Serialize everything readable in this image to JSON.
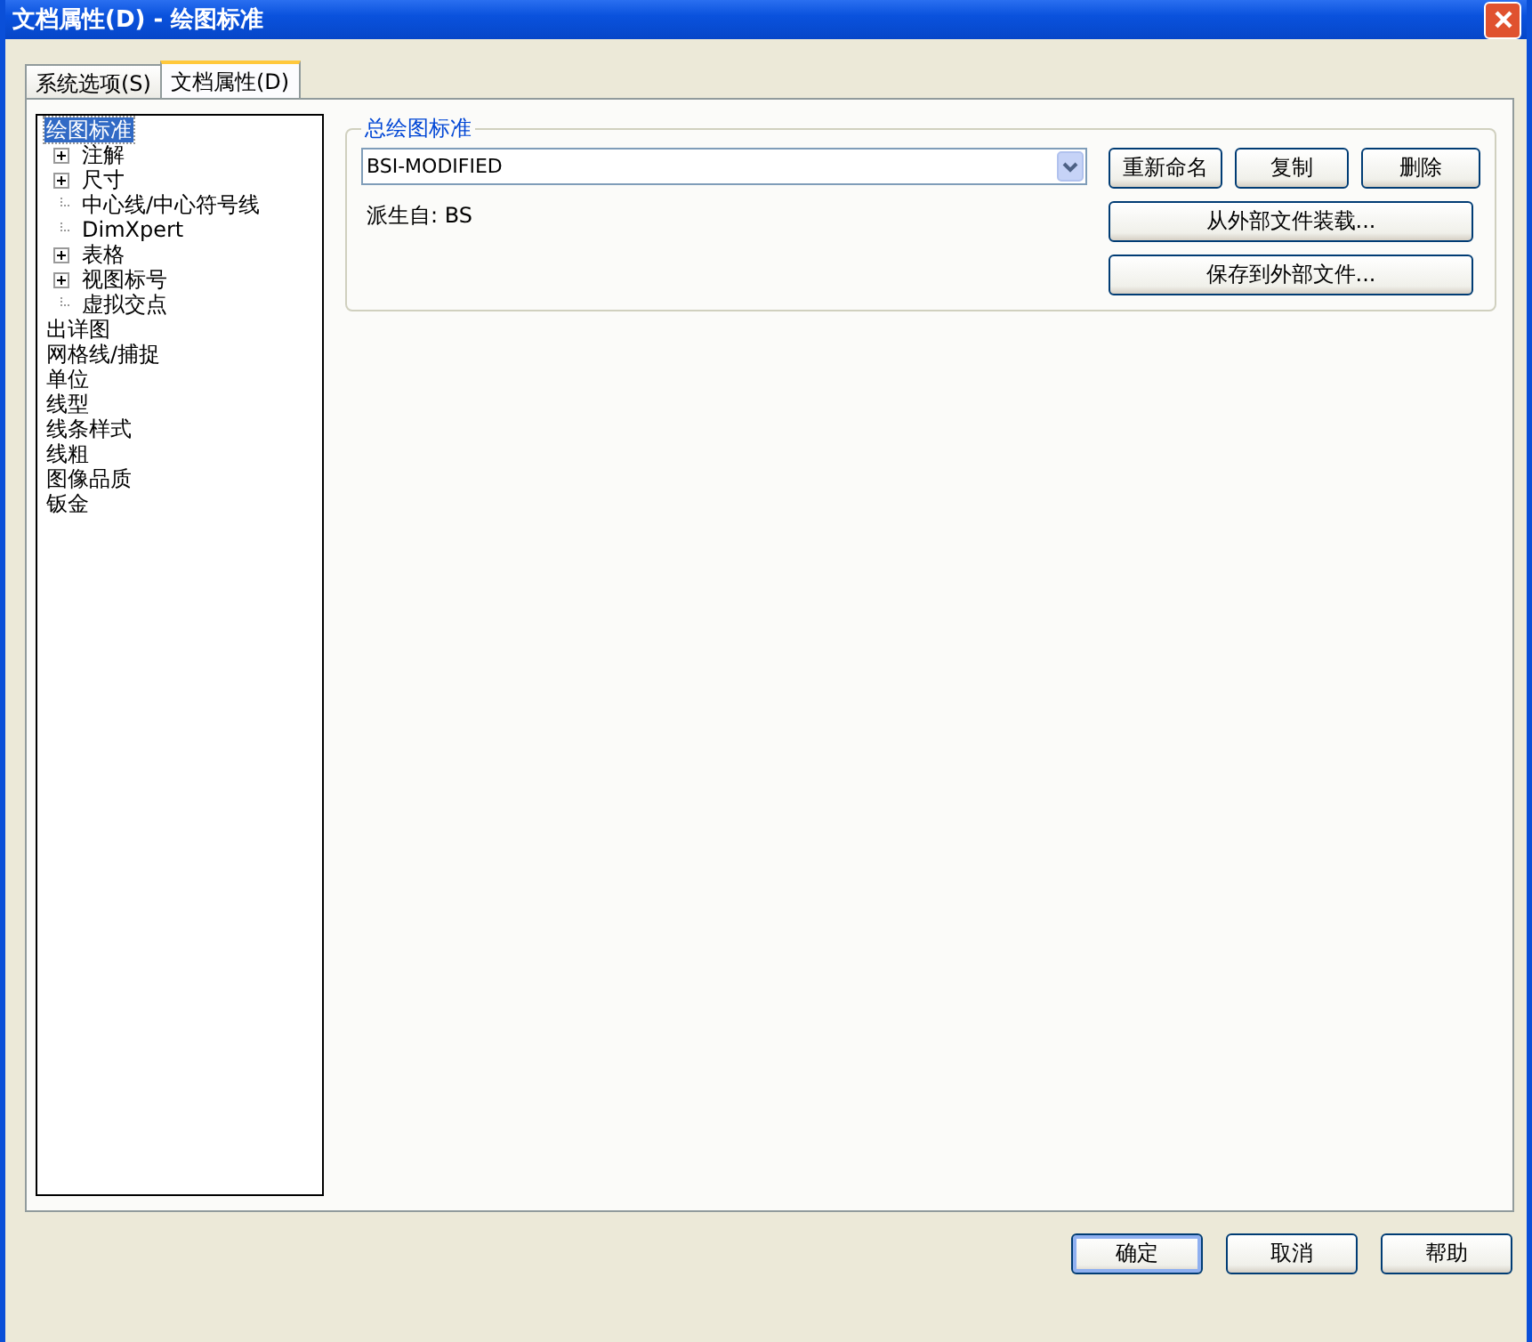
{
  "window": {
    "title": "文档属性(D) - 绘图标准"
  },
  "tabs": [
    {
      "label": "系统选项(S)",
      "selected": false
    },
    {
      "label": "文档属性(D)",
      "selected": true
    }
  ],
  "tree": [
    {
      "label": "绘图标准",
      "selected": true,
      "children": [
        {
          "label": "注解",
          "kind": "folder"
        },
        {
          "label": "尺寸",
          "kind": "folder"
        },
        {
          "label": "中心线/中心符号线",
          "kind": "leaf"
        },
        {
          "label": "DimXpert",
          "kind": "leaf"
        },
        {
          "label": "表格",
          "kind": "folder"
        },
        {
          "label": "视图标号",
          "kind": "folder"
        },
        {
          "label": "虚拟交点",
          "kind": "leaf"
        }
      ]
    },
    {
      "label": "出详图",
      "selected": false
    },
    {
      "label": "网格线/捕捉",
      "selected": false
    },
    {
      "label": "单位",
      "selected": false
    },
    {
      "label": "线型",
      "selected": false
    },
    {
      "label": "线条样式",
      "selected": false
    },
    {
      "label": "线粗",
      "selected": false
    },
    {
      "label": "图像品质",
      "selected": false
    },
    {
      "label": "钣金",
      "selected": false
    }
  ],
  "group": {
    "title": "总绘图标准",
    "standard": "BSI-MODIFIED",
    "derived": "派生自: BS",
    "buttons": [
      "重新命名",
      "复制",
      "删除"
    ],
    "wide_buttons": [
      "从外部文件装载...",
      "保存到外部文件..."
    ]
  },
  "buttons": [
    {
      "label": "确定",
      "default": true
    },
    {
      "label": "取消",
      "default": false
    },
    {
      "label": "帮助",
      "default": false
    }
  ]
}
